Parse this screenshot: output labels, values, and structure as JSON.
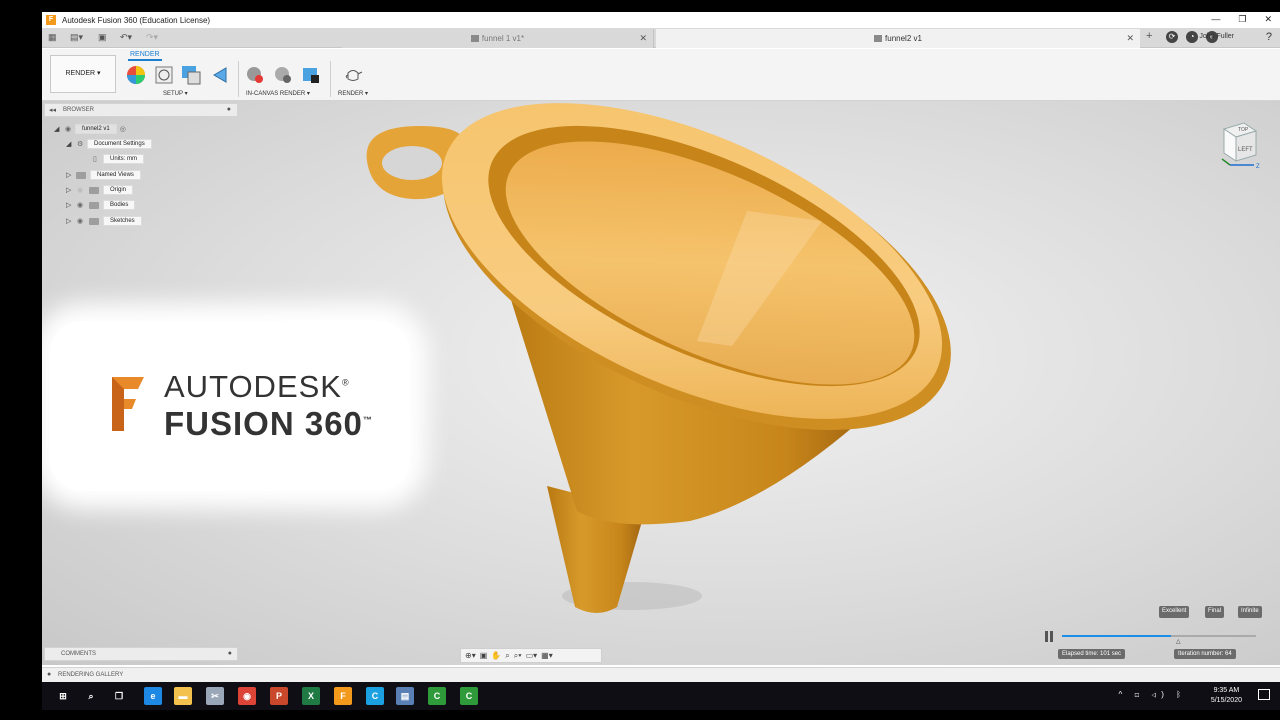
{
  "window": {
    "title": "Autodesk Fusion 360 (Education License)",
    "controls": [
      "—",
      "❐",
      "✕"
    ]
  },
  "tabs": [
    {
      "label": "funnel 1 v1*",
      "active": false
    },
    {
      "label": "funnel2 v1",
      "active": true
    }
  ],
  "header": {
    "user": "John Fuller"
  },
  "ribbon": {
    "workspace": "RENDER ▾",
    "tab": "RENDER",
    "groups": {
      "setup": "SETUP ▾",
      "in_canvas": "IN-CANVAS RENDER ▾",
      "render": "RENDER ▾"
    }
  },
  "browser": {
    "title": "BROWSER",
    "root": "funnel2 v1",
    "document_settings": "Document Settings",
    "units": "Units: mm",
    "items": [
      "Named Views",
      "Origin",
      "Bodies",
      "Sketches"
    ]
  },
  "logo": {
    "line1": "AUTODESK",
    "line1_mark": "®",
    "line2": "FUSION 360",
    "line2_mark": "™"
  },
  "viewcube": {
    "face": "LEFT",
    "top": "TOP",
    "axis_z": "Z",
    "axis_y": "Y"
  },
  "render_progress": {
    "qualities": [
      "Excellent",
      "Final",
      "Infinite"
    ],
    "elapsed": "Elapsed time: 101 sec",
    "iteration": "Iteration number: 64",
    "progress_fraction": 0.56
  },
  "comments": {
    "title": "COMMENTS"
  },
  "gallery": {
    "title": "RENDERING GALLERY"
  },
  "taskbar": {
    "time": "9:35 AM",
    "date": "5/15/2020",
    "apps": [
      {
        "name": "windows",
        "color": "#ffffff"
      },
      {
        "name": "search",
        "color": "#ffffff"
      },
      {
        "name": "task-view",
        "color": "#ffffff"
      },
      {
        "name": "edge",
        "color": "#1e88e5"
      },
      {
        "name": "explorer",
        "color": "#f2c14e"
      },
      {
        "name": "snipping",
        "color": "#9aa7b8"
      },
      {
        "name": "chrome",
        "color": "#db4437"
      },
      {
        "name": "powerpoint",
        "color": "#c9472b"
      },
      {
        "name": "excel",
        "color": "#1f7a44"
      },
      {
        "name": "fusion",
        "color": "#f39a1d"
      },
      {
        "name": "cura",
        "color": "#1ba1e2"
      },
      {
        "name": "notepad",
        "color": "#5a7fb5"
      },
      {
        "name": "camtasia-1",
        "color": "#2e9a3a"
      },
      {
        "name": "camtasia-2",
        "color": "#2e9a3a"
      }
    ]
  }
}
